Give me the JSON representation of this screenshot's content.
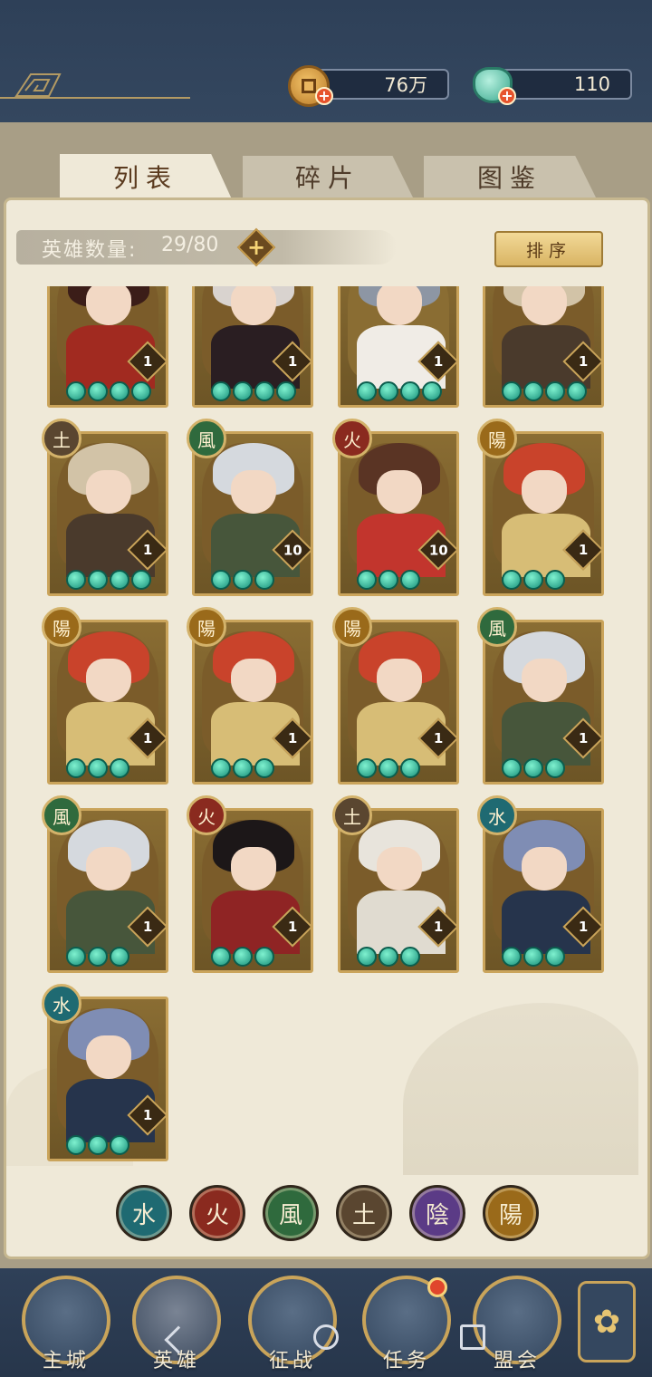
{
  "currency": {
    "coins": {
      "value": "76万",
      "icon": "coin-icon"
    },
    "jade": {
      "value": "110",
      "icon": "jade-pouch-icon"
    }
  },
  "tabs": [
    {
      "label": "列表",
      "active": true
    },
    {
      "label": "碎片",
      "active": false
    },
    {
      "label": "图鉴",
      "active": false
    }
  ],
  "hero_count": {
    "label": "英雄数量:",
    "value": "29/80"
  },
  "sort_button": "排序",
  "heroes": [
    {
      "element": "",
      "level": "1",
      "stars": 4,
      "palette": "red-robe"
    },
    {
      "element": "",
      "level": "1",
      "stars": 4,
      "palette": "dark-cloak"
    },
    {
      "element": "",
      "level": "1",
      "stars": 4,
      "palette": "white-robe"
    },
    {
      "element": "",
      "level": "1",
      "stars": 4,
      "palette": "pale-witch"
    },
    {
      "element": "土",
      "element_key": "earth",
      "level": "1",
      "stars": 4,
      "palette": "pale-witch"
    },
    {
      "element": "風",
      "element_key": "wind",
      "level": "10",
      "stars": 3,
      "palette": "silver-fighter"
    },
    {
      "element": "火",
      "element_key": "fire",
      "level": "10",
      "stars": 3,
      "palette": "red-dress"
    },
    {
      "element": "陽",
      "element_key": "yang",
      "level": "1",
      "stars": 3,
      "palette": "red-hair"
    },
    {
      "element": "陽",
      "element_key": "yang",
      "level": "1",
      "stars": 3,
      "palette": "red-hair"
    },
    {
      "element": "陽",
      "element_key": "yang",
      "level": "1",
      "stars": 3,
      "palette": "red-hair"
    },
    {
      "element": "陽",
      "element_key": "yang",
      "level": "1",
      "stars": 3,
      "palette": "red-hair"
    },
    {
      "element": "風",
      "element_key": "wind",
      "level": "1",
      "stars": 3,
      "palette": "silver-fighter"
    },
    {
      "element": "風",
      "element_key": "wind",
      "level": "1",
      "stars": 3,
      "palette": "silver-fighter"
    },
    {
      "element": "火",
      "element_key": "fire",
      "level": "1",
      "stars": 3,
      "palette": "black-hair"
    },
    {
      "element": "土",
      "element_key": "earth",
      "level": "1",
      "stars": 3,
      "palette": "white-fur"
    },
    {
      "element": "水",
      "element_key": "water",
      "level": "1",
      "stars": 3,
      "palette": "blue-ninja"
    },
    {
      "element": "水",
      "element_key": "water",
      "level": "1",
      "stars": 3,
      "palette": "blue-ninja"
    }
  ],
  "element_filters": [
    {
      "glyph": "水",
      "key": "water"
    },
    {
      "glyph": "火",
      "key": "fire"
    },
    {
      "glyph": "風",
      "key": "wind"
    },
    {
      "glyph": "土",
      "key": "earth"
    },
    {
      "glyph": "陰",
      "key": "yin"
    },
    {
      "glyph": "陽",
      "key": "yang"
    }
  ],
  "nav": [
    {
      "label": "主城",
      "icon": "castle-icon"
    },
    {
      "label": "英雄",
      "icon": "hero-hat-icon",
      "active": true
    },
    {
      "label": "征战",
      "icon": "helmet-icon"
    },
    {
      "label": "任务",
      "icon": "scroll-icon",
      "badge": true
    },
    {
      "label": "盟会",
      "icon": "pavilion-icon"
    }
  ],
  "side_button_icon": "flower-menu-icon",
  "colors": {
    "frame_gold": "#caa45b",
    "panel_bg": "#efe9d8",
    "navy": "#2c3a50",
    "star_jade": "#18907a"
  }
}
